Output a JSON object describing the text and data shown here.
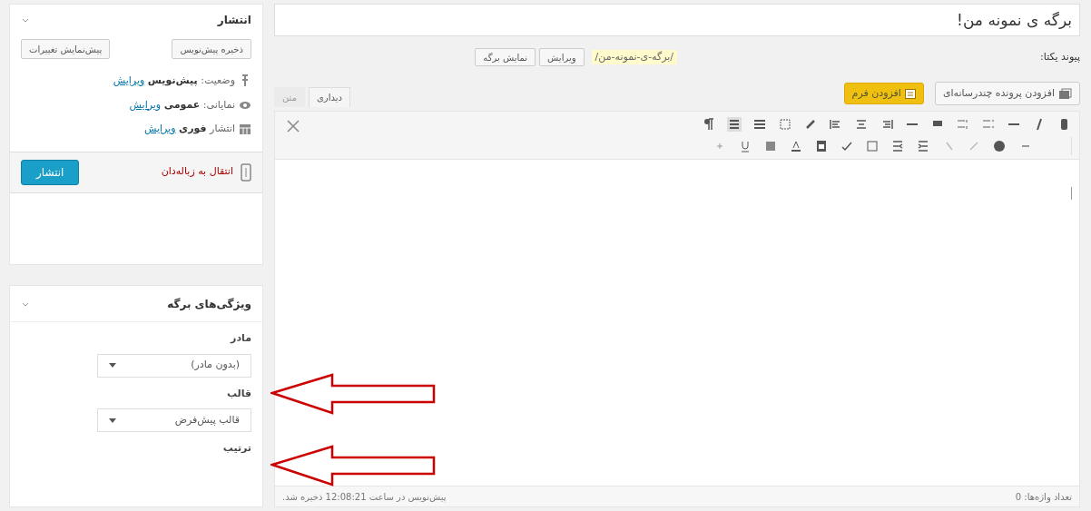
{
  "title": "برگه ی نمونه من!",
  "permalink": {
    "label": "پیوند یکتا:",
    "url": "/برگه-ی-نمونه-من/",
    "buttons": [
      "ویرایش",
      "نمایش برگه"
    ]
  },
  "media_button": "افزودن پرونده چندرسانه‌ای",
  "form_button": "افزودن فرم",
  "editor_tabs": [
    {
      "label": "دیداری",
      "selected": true
    },
    {
      "label": "متن",
      "selected": false
    }
  ],
  "status_bar": {
    "word_count": "تعداد واژه‌ها: 0",
    "last_saved": "پیش‌نویس در ساعت 12:08:21 ذخیره شد."
  },
  "publish_box": {
    "title": "انتشار",
    "save_draft": "ذخیره پیش‌نویس",
    "preview": "پیش‌نمایش تغییرات",
    "rows": [
      {
        "kind": "status",
        "label": "وضعیت:",
        "value": "پیش‌نویس",
        "link": "ویرایش"
      },
      {
        "kind": "visibility",
        "label": "نمایانی:",
        "value": "عمومی",
        "link": "ویرایش"
      },
      {
        "kind": "schedule",
        "label": "انتشار",
        "value": "فوری",
        "link": "ویرایش"
      }
    ],
    "trash": "انتقال به زباله‌دان",
    "publish": "انتشار"
  },
  "attributes_box": {
    "title": "ویژگی‌های برگه",
    "parent_label": "مادر",
    "parent_value": "(بدون مادر)",
    "template_label": "قالب",
    "template_value": "قالب پیش‌فرض",
    "order_label": "ترتیب"
  }
}
